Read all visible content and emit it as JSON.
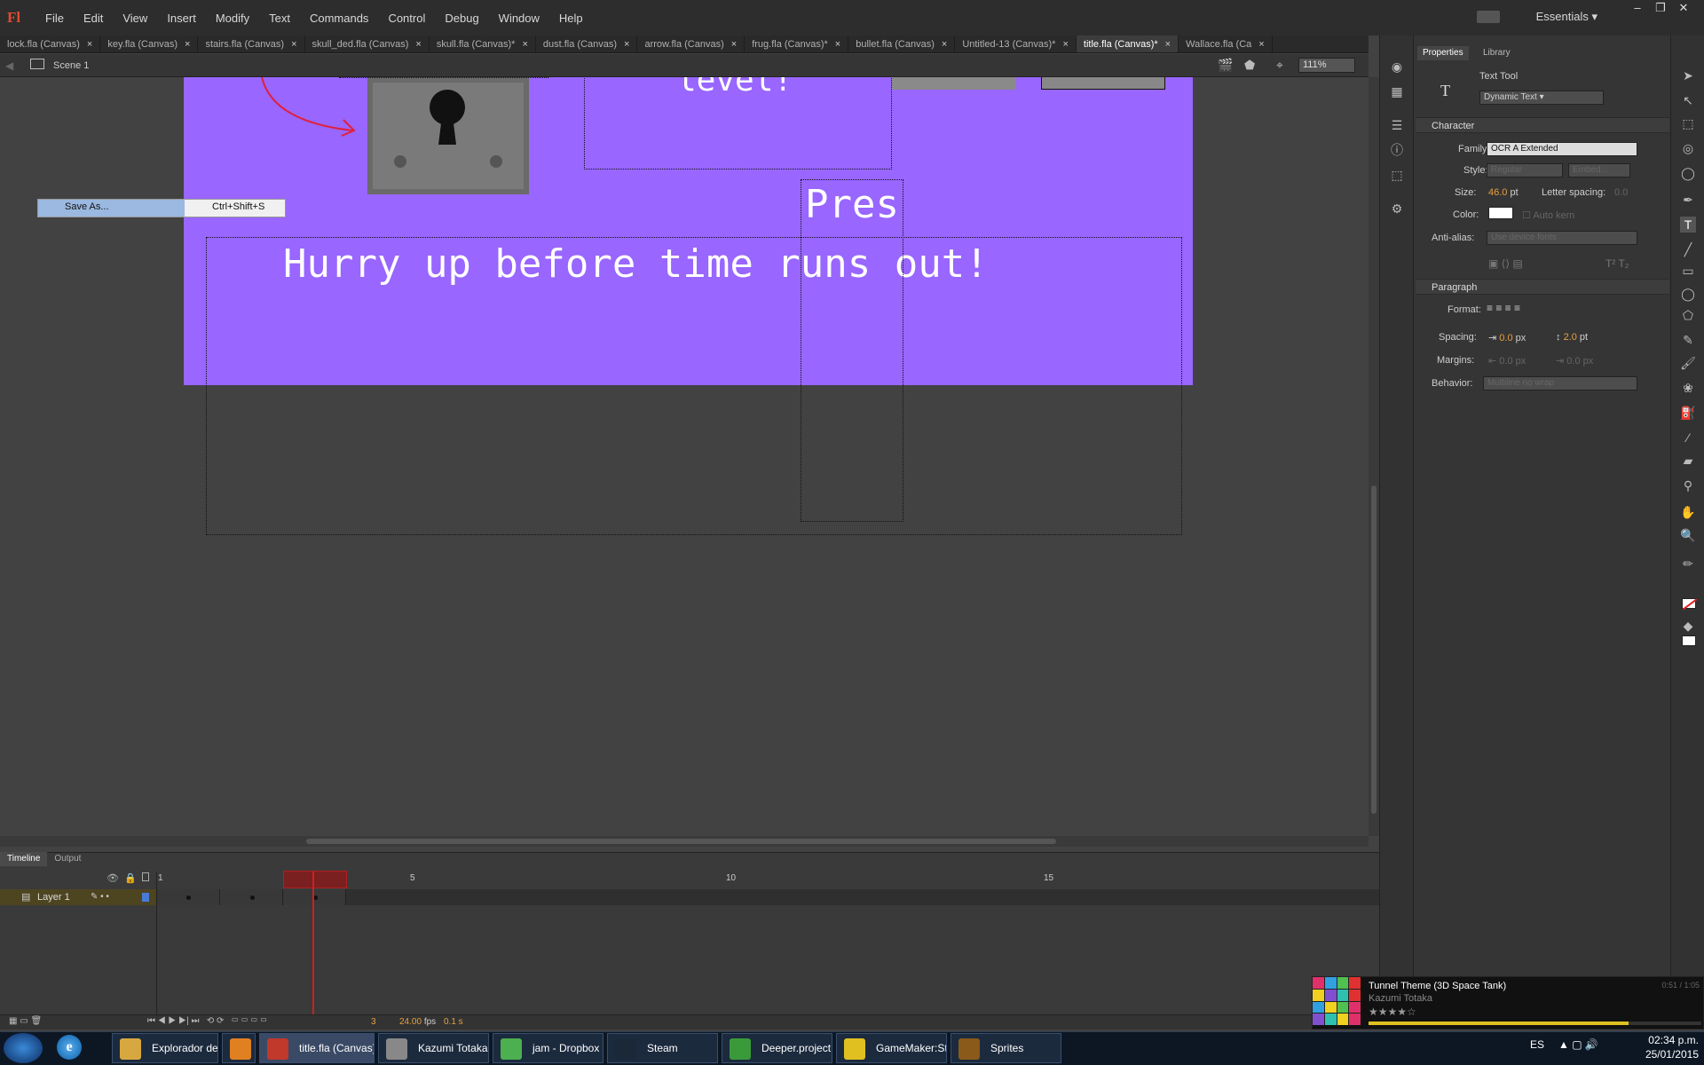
{
  "app": {
    "logo": "Fl",
    "menus": [
      "File",
      "Edit",
      "View",
      "Insert",
      "Modify",
      "Text",
      "Commands",
      "Control",
      "Debug",
      "Window",
      "Help"
    ],
    "workspace": "Essentials"
  },
  "doc_tabs": [
    {
      "label": "lock.fla (Canvas)",
      "active": false
    },
    {
      "label": "key.fla (Canvas)",
      "active": false
    },
    {
      "label": "stairs.fla (Canvas)",
      "active": false
    },
    {
      "label": "skull_ded.fla (Canvas)",
      "active": false
    },
    {
      "label": "skull.fla (Canvas)*",
      "active": false
    },
    {
      "label": "dust.fla (Canvas)",
      "active": false
    },
    {
      "label": "arrow.fla (Canvas)",
      "active": false
    },
    {
      "label": "frug.fla (Canvas)*",
      "active": false
    },
    {
      "label": "bullet.fla (Canvas)",
      "active": false
    },
    {
      "label": "Untitled-13 (Canvas)*",
      "active": false
    },
    {
      "label": "title.fla (Canvas)*",
      "active": true
    },
    {
      "label": "Wallace.fla (Ca",
      "active": false
    }
  ],
  "edit_bar": {
    "scene": "Scene 1",
    "zoom": "111%"
  },
  "stage": {
    "background": "#9966ff",
    "text_level": "level!",
    "text_pres": "Pres",
    "text_hurry": "Hurry up before time runs out!"
  },
  "context_menu": {
    "label": "Save As...",
    "shortcut": "Ctrl+Shift+S"
  },
  "properties": {
    "tabs": [
      "Properties",
      "Library"
    ],
    "tool": "Text Tool",
    "text_type": "Dynamic Text",
    "character": {
      "header": "Character",
      "family_label": "Family:",
      "family": "OCR A Extended",
      "style_label": "Style:",
      "style": "Regular",
      "embed": "Embed...",
      "size_label": "Size:",
      "size": "46.0",
      "size_unit": "pt",
      "letter_spacing_label": "Letter spacing:",
      "letter_spacing": "0.0",
      "color_label": "Color:",
      "auto_kern": "Auto kern",
      "antialias_label": "Anti-alias:",
      "antialias": "Use device fonts"
    },
    "paragraph": {
      "header": "Paragraph",
      "format_label": "Format:",
      "spacing_label": "Spacing:",
      "spacing_indent": "0.0",
      "spacing_indent_unit": "px",
      "spacing_line": "2.0",
      "spacing_line_unit": "pt",
      "margins_label": "Margins:",
      "margin_left": "0.0 px",
      "margin_right": "0.0 px",
      "behavior_label": "Behavior:",
      "behavior": "Multiline no wrap"
    }
  },
  "timeline": {
    "tabs": [
      "Timeline",
      "Output"
    ],
    "frame_numbers": [
      "1",
      "5",
      "10",
      "15"
    ],
    "layer_name": "Layer 1",
    "current_frame": "3",
    "fps": "24.00",
    "fps_unit": "fps",
    "elapsed": "0.1 s"
  },
  "taskbar": {
    "items": [
      {
        "label": "Explorador de W...",
        "icon": "folder-icon",
        "color": "#d8a840"
      },
      {
        "label": "",
        "icon": "media-player-icon",
        "color": "#e08020"
      },
      {
        "label": "title.fla (Canvas)*",
        "icon": "flash-icon",
        "color": "#c0392b"
      },
      {
        "label": "Kazumi Totaka - ...",
        "icon": "music-player-icon",
        "color": "#888888"
      },
      {
        "label": "jam - Dropbox - G...",
        "icon": "chrome-icon",
        "color": "#4caf50"
      },
      {
        "label": "Steam",
        "icon": "steam-icon",
        "color": "#1b2838"
      },
      {
        "label": "Deeper.project.g...",
        "icon": "gamemaker-project-icon",
        "color": "#3a9a3a"
      },
      {
        "label": "GameMaker:Studio",
        "icon": "gamemaker-icon",
        "color": "#e0c020"
      },
      {
        "label": "Sprites",
        "icon": "bridge-icon",
        "color": "#8a5a1a"
      }
    ],
    "lang": "ES",
    "time": "02:34 p.m.",
    "date": "25/01/2015"
  },
  "now_playing": {
    "title": "Tunnel Theme (3D Space Tank)",
    "artist": "Kazumi Totaka",
    "time": "0:51 / 1:05",
    "rating": 4,
    "rating_max": 5
  }
}
